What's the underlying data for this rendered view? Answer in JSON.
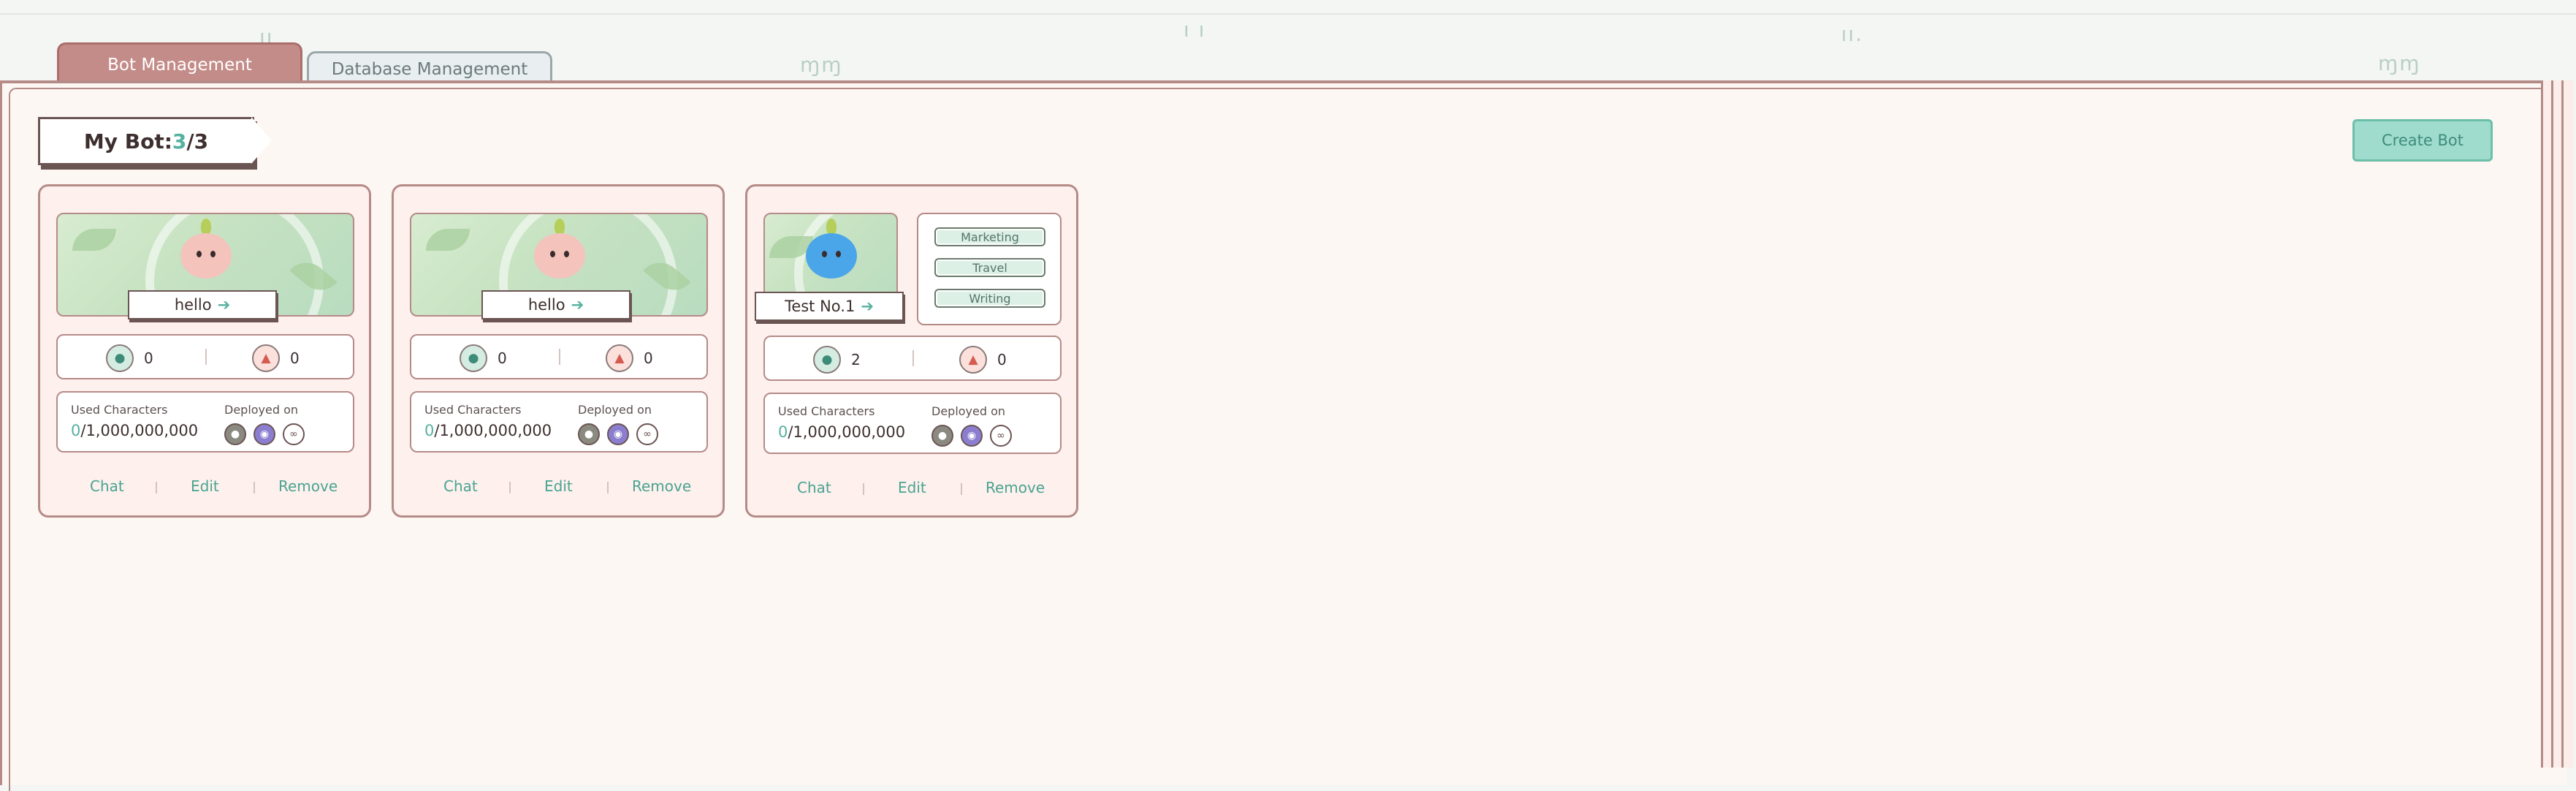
{
  "tabs": {
    "bot_management": "Bot Management",
    "database_management": "Database Management"
  },
  "header": {
    "title_prefix": "My Bot: ",
    "bot_count": "3",
    "bot_limit": "/3",
    "create_button": "Create Bot"
  },
  "colors": {
    "accent": "#55b1a0",
    "tab_active": "#c48c88",
    "card_border": "#b58b88",
    "create_button": "#9fdccd"
  },
  "bots": [
    {
      "name": "hello",
      "avatar": "pink-blob-character",
      "tags": [],
      "chat_count": "0",
      "like_count": "0",
      "used_label": "Used Characters",
      "used_value": "0",
      "used_limit": "/1,000,000,000",
      "deployed_label": "Deployed on",
      "deployed_icons": [
        "platform-icon",
        "discord-icon",
        "link-icon"
      ],
      "actions": {
        "chat": "Chat",
        "edit": "Edit",
        "remove": "Remove"
      }
    },
    {
      "name": "hello",
      "avatar": "pink-blob-character",
      "tags": [],
      "chat_count": "0",
      "like_count": "0",
      "used_label": "Used Characters",
      "used_value": "0",
      "used_limit": "/1,000,000,000",
      "deployed_label": "Deployed on",
      "deployed_icons": [
        "platform-icon",
        "discord-icon",
        "link-icon"
      ],
      "actions": {
        "chat": "Chat",
        "edit": "Edit",
        "remove": "Remove"
      }
    },
    {
      "name": "Test No.1",
      "avatar": "blue-blob-character",
      "tags": [
        "Marketing",
        "Travel",
        "Writing"
      ],
      "chat_count": "2",
      "like_count": "0",
      "used_label": "Used Characters",
      "used_value": "0",
      "used_limit": "/1,000,000,000",
      "deployed_label": "Deployed on",
      "deployed_icons": [
        "platform-icon",
        "discord-icon",
        "link-icon"
      ],
      "actions": {
        "chat": "Chat",
        "edit": "Edit",
        "remove": "Remove"
      }
    }
  ]
}
